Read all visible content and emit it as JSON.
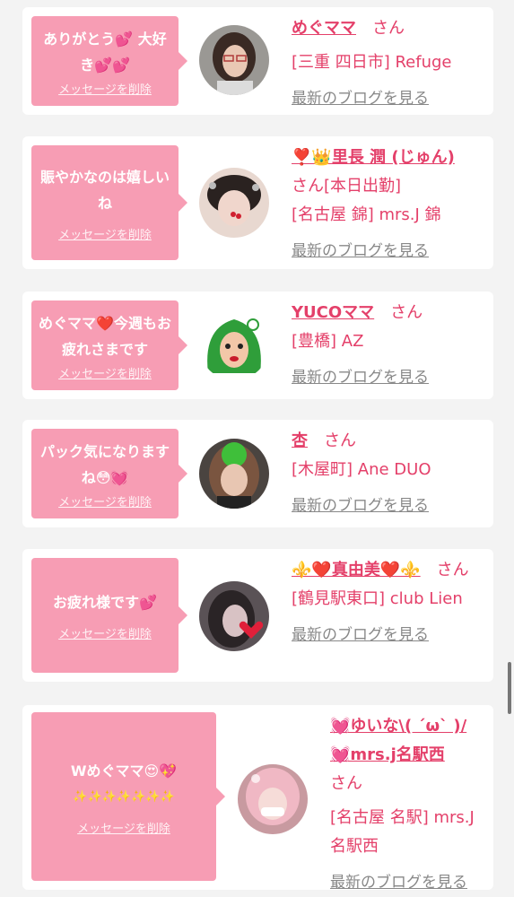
{
  "cards": [
    {
      "message": "ありがとう💕 大好き💕💕",
      "delete_label": "メッセージを削除",
      "name": "めぐママ",
      "san": "さん",
      "shop": "[三重 四日市] Refuge",
      "blog_label": "最新のブログを見る"
    },
    {
      "message": "賑やかなのは嬉しいね",
      "delete_label": "メッセージを削除",
      "name": "❣️👑里長 潤 (じゅん)",
      "san": "さん[本日出勤]",
      "shop": "[名古屋 錦] mrs.J 錦",
      "blog_label": "最新のブログを見る"
    },
    {
      "message": "めぐママ❤️今週もお疲れさまです",
      "delete_label": "メッセージを削除",
      "name": "YUCOママ",
      "san": "さん",
      "shop": "[豊橋] AZ",
      "blog_label": "最新のブログを見る"
    },
    {
      "message": "パック気になりますね😳💓",
      "delete_label": "メッセージを削除",
      "name": "杏",
      "san": "さん",
      "shop": "[木屋町] Ane DUO",
      "blog_label": "最新のブログを見る"
    },
    {
      "message": "お疲れ様です💕",
      "delete_label": "メッセージを削除",
      "name": "⚜️❤️真由美❤️⚜️",
      "san": "さん",
      "shop": "[鶴見駅東口] club Lien",
      "blog_label": "最新のブログを見る"
    },
    {
      "message": "Wめぐママ😍💖",
      "message_line2": "✨✨✨✨✨✨✨",
      "delete_label": "メッセージを削除",
      "name": "💓ゆいな\\( ´ω` )/💓mrs.j名駅西",
      "san": "さん",
      "shop": "[名古屋 名駅] mrs.J 名駅西",
      "blog_label": "最新のブログを見る"
    }
  ],
  "colors": {
    "accent": "#e4406a",
    "bubble": "#f79db4",
    "background": "#f3f3f3"
  }
}
